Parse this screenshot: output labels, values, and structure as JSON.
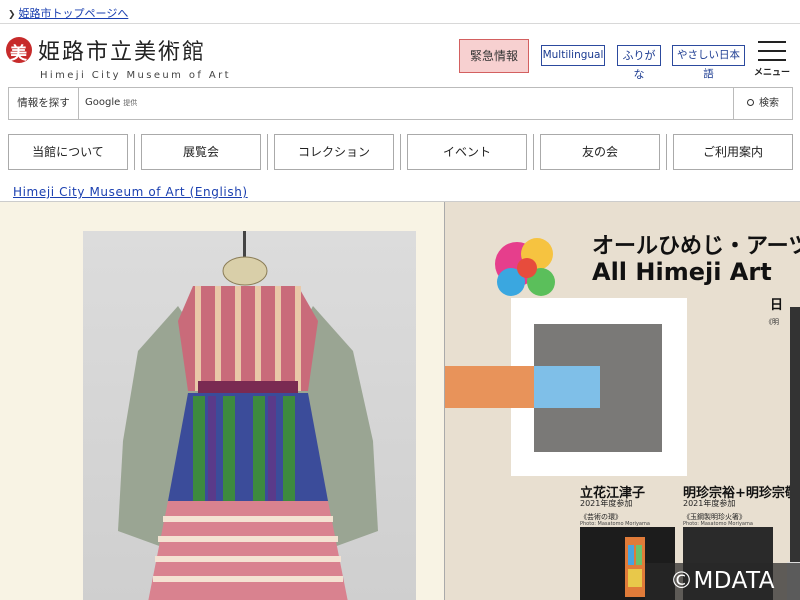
{
  "breadcrumb": {
    "label": "姫路市トップページへ"
  },
  "header": {
    "logo_mark": "美",
    "title_ja": "姫路市立美術館",
    "title_en": "Himeji City Museum of Art",
    "emergency_label": "緊急情報",
    "multilingual_label": "Multilingual",
    "furigana_label": "ふりがな",
    "easy_japanese_label": "やさしい日本語",
    "menu_label": "メニュー"
  },
  "search": {
    "label": "情報を探す",
    "brand": "Google",
    "brand_suffix": "提供",
    "value": "",
    "placeholder": "",
    "button_label": "検索"
  },
  "nav": {
    "items": [
      {
        "label": "当館について"
      },
      {
        "label": "展覧会"
      },
      {
        "label": "コレクション"
      },
      {
        "label": "イベント"
      },
      {
        "label": "友の会"
      },
      {
        "label": "ご利用案内"
      }
    ]
  },
  "english_link": "Himeji City Museum of Art (English)",
  "hero": {
    "poster": {
      "title_ja": "オールひめじ・アーツ",
      "title_en": "All Himeji Art",
      "side_char": "日",
      "side_text": "《明",
      "artists": [
        {
          "name": "立花江津子",
          "year": "2021年度参加",
          "work": "《芸術の環》",
          "photo": "Photo: Masatomo Moriyama"
        },
        {
          "name": "明珍宗裕+明珍宗敬",
          "year": "2021年度参加",
          "work": "《玉鋼製明珍火箸》",
          "photo": "Photo: Masatomo Moriyama"
        }
      ]
    },
    "watermark": "©MDATA"
  },
  "colors": {
    "link": "#1a3fb0",
    "logo_red": "#c72b2b",
    "emergency_bg": "#f7d0d0",
    "emergency_border": "#d36060",
    "hero_left_bg": "#f8f3e4",
    "hero_right_bg": "#e8dfd0",
    "poster_orange": "#e8935a",
    "poster_blue": "#7fbfe8",
    "poster_gray": "#7a7977"
  }
}
